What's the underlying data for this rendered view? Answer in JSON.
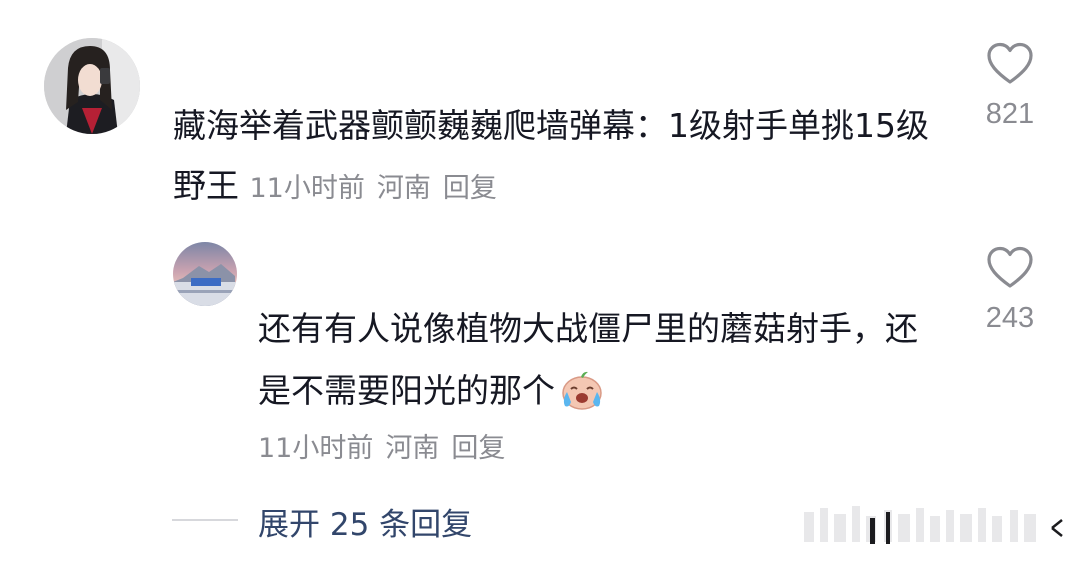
{
  "comment": {
    "text": "藏海举着武器颤颤巍巍爬墙弹幕：1级射手单挑15级野王",
    "time": "11小时前",
    "location": "河南",
    "reply_label": "回复",
    "like_count": "821",
    "like_icon": "heart-outline-icon"
  },
  "reply": {
    "text": "还有有人说像植物大战僵尸里的蘑菇射手，还是不需要阳光的那个",
    "emoji": "crying-face-icon",
    "time": "11小时前",
    "location": "河南",
    "reply_label": "回复",
    "like_count": "243",
    "like_icon": "heart-outline-icon"
  },
  "expand": {
    "label": "展开 25 条回复"
  },
  "colors": {
    "text": "#161823",
    "meta": "#8a8b91",
    "expand_link": "#32466b"
  }
}
